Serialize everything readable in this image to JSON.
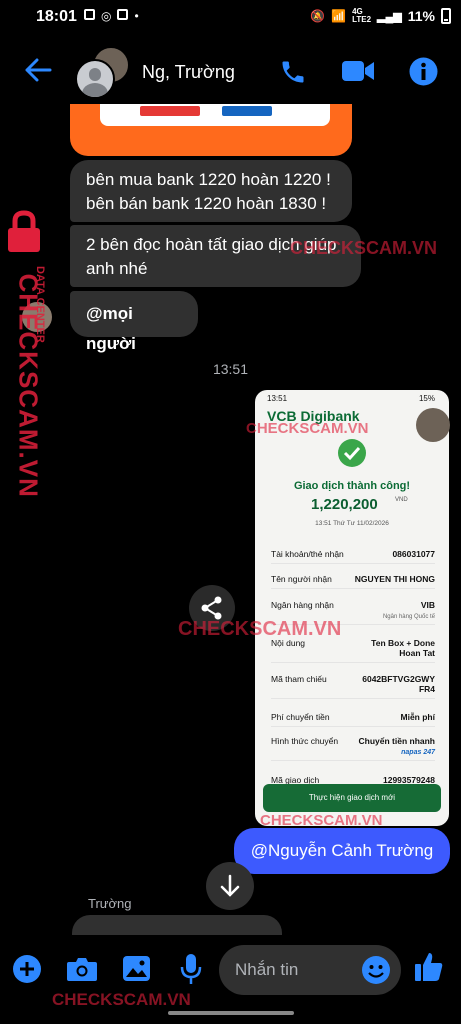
{
  "status_bar": {
    "time": "18:01",
    "network": "4G\nLTE2",
    "battery": "11%"
  },
  "header": {
    "contact_name": "Ng, Trường"
  },
  "messages": {
    "msg1_line1": "bên mua bank 1220 hoàn 1220 !",
    "msg1_line2": "bên bán bank 1220 hoàn 1830 !",
    "msg2_line1": "2 bên đọc hoàn tất giao dịch giúp",
    "msg2_line2": "anh nhé",
    "msg3": "@mọi người",
    "timestamp": "13:51",
    "mention_out": "@Nguyễn Cảnh Trường",
    "sender_label": "Trường"
  },
  "receipt": {
    "status_time": "13:51",
    "status_battery": "15%",
    "bank_logo": "VCB Digibank",
    "title": "Giao dịch thành công!",
    "amount": "1,220,200",
    "currency": "VND",
    "datetime": "13:51 Thứ Tư 11/02/2026",
    "rows": [
      {
        "label": "Tài khoản/thẻ nhận",
        "value": "086031077"
      },
      {
        "label": "Tên người nhận",
        "value": "NGUYEN THI HONG"
      },
      {
        "label": "Ngân hàng nhận",
        "value": "VIB",
        "sub": "Ngân hàng Quốc tế"
      },
      {
        "label": "Nội dung",
        "value": "Ten Box + Done\nHoan Tat"
      },
      {
        "label": "Mã tham chiếu",
        "value": "6042BFTVG2GWY\nFR4"
      },
      {
        "label": "Phí chuyển tiền",
        "value": "Miễn phí"
      },
      {
        "label": "Hình thức chuyển",
        "value": "Chuyển tiền nhanh",
        "sub": "napas 247"
      },
      {
        "label": "Mã giao dịch",
        "value": "12993579248"
      }
    ],
    "button": "Thực hiện giao dịch mới"
  },
  "composer": {
    "placeholder": "Nhắn tin"
  },
  "watermark": {
    "brand": "CHECKSCAM.VN",
    "tag": "DATA CENTER"
  },
  "icons": [
    "back-arrow-icon",
    "phone-icon",
    "video-camera-icon",
    "info-icon",
    "share-icon",
    "scroll-down-icon",
    "plus-icon",
    "camera-icon",
    "gallery-icon",
    "microphone-icon",
    "emoji-icon",
    "thumbs-up-icon"
  ],
  "colors": {
    "accent": "#2d88ff",
    "bubble_in": "#303030",
    "bubble_out": "#3d5afe",
    "watermark": "#e0203b"
  }
}
